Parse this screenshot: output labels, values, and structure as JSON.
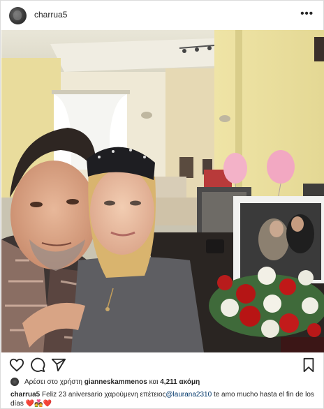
{
  "header": {
    "username": "charrua5"
  },
  "colors": {
    "heart": "#c0392b",
    "mention": "#00376b",
    "text": "#262626"
  },
  "icons": [
    "heart-icon",
    "comment-icon",
    "share-icon",
    "bookmark-icon",
    "more-options-icon"
  ],
  "likes": {
    "prefix": "Αρέσει στο χρήστη",
    "user": "gianneskammenos",
    "connector": "και",
    "count": "4,211 ακόμη"
  },
  "caption": {
    "user": "charrua5",
    "text_before": "Feliz 23 aniversario χαρούμενη επέτειος",
    "mention": "@laurana2310",
    "text_after": "te amo mucho hasta el fin de los días",
    "emoji": "❤️💑❤️"
  }
}
